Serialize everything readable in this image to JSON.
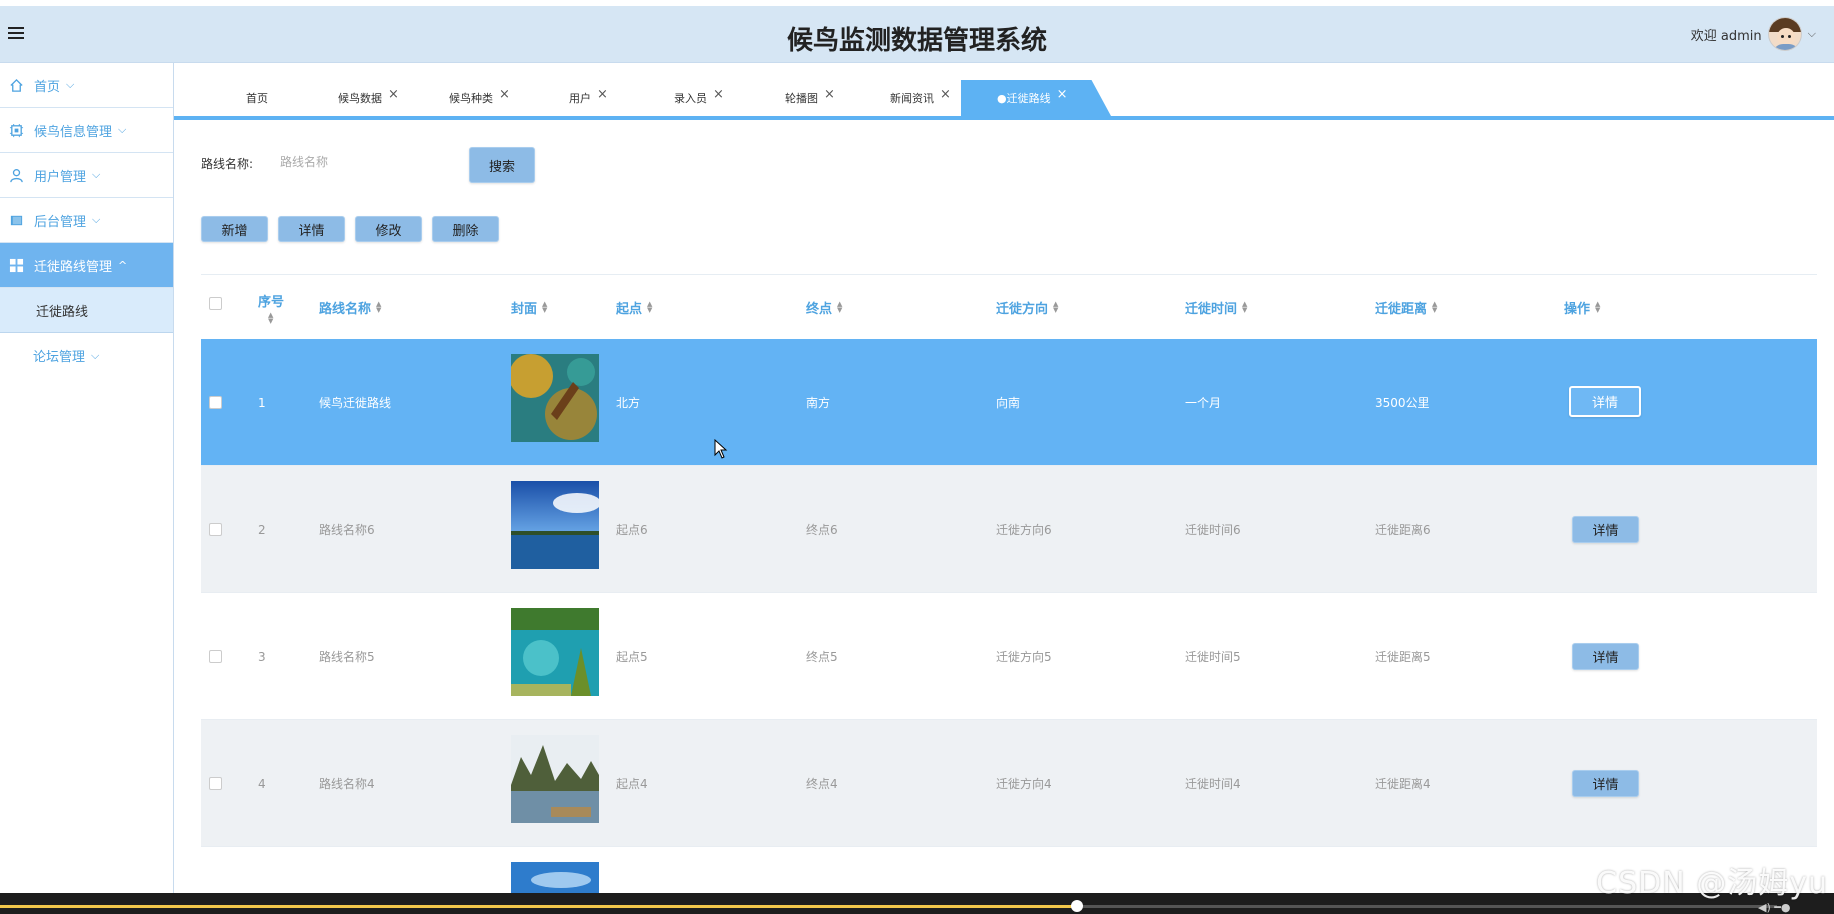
{
  "header": {
    "title": "候鸟监测数据管理系统",
    "welcome": "欢迎 admin"
  },
  "sidebar": {
    "items": [
      {
        "label": "首页",
        "icon": "home-icon",
        "arrow": "⌵"
      },
      {
        "label": "候鸟信息管理",
        "icon": "chip-icon",
        "arrow": "⌵"
      },
      {
        "label": "用户管理",
        "icon": "user-icon",
        "arrow": "⌵"
      },
      {
        "label": "后台管理",
        "icon": "book-icon",
        "arrow": "⌵"
      },
      {
        "label": "迁徙路线管理",
        "icon": "grid-icon",
        "arrow": "^"
      },
      {
        "label": "迁徙路线"
      },
      {
        "label": "论坛管理",
        "arrow": "⌵"
      }
    ]
  },
  "tabs": [
    {
      "label": "首页"
    },
    {
      "label": "候鸟数据",
      "close": "×"
    },
    {
      "label": "候鸟种类",
      "close": "×"
    },
    {
      "label": "用户",
      "close": "×"
    },
    {
      "label": "录入员",
      "close": "×"
    },
    {
      "label": "轮播图",
      "close": "×"
    },
    {
      "label": "新闻资讯",
      "close": "×"
    },
    {
      "label": "●迁徙路线",
      "close": "×"
    }
  ],
  "search": {
    "label": "路线名称:",
    "placeholder": "路线名称",
    "button": "搜索"
  },
  "actions": {
    "add": "新增",
    "detail": "详情",
    "edit": "修改",
    "delete": "删除"
  },
  "table": {
    "columns": [
      "序号",
      "路线名称",
      "封面",
      "起点",
      "终点",
      "迁徙方向",
      "迁徙时间",
      "迁徙距离",
      "操作"
    ],
    "rows": [
      {
        "index": "1",
        "name": "候鸟迁徙路线",
        "start": "北方",
        "end": "南方",
        "direction": "向南",
        "time": "一个月",
        "distance": "3500公里",
        "action": "详情"
      },
      {
        "index": "2",
        "name": "路线名称6",
        "start": "起点6",
        "end": "终点6",
        "direction": "迁徙方向6",
        "time": "迁徙时间6",
        "distance": "迁徙距离6",
        "action": "详情"
      },
      {
        "index": "3",
        "name": "路线名称5",
        "start": "起点5",
        "end": "终点5",
        "direction": "迁徙方向5",
        "time": "迁徙时间5",
        "distance": "迁徙距离5",
        "action": "详情"
      },
      {
        "index": "4",
        "name": "路线名称4",
        "start": "起点4",
        "end": "终点4",
        "direction": "迁徙方向4",
        "time": "迁徙时间4",
        "distance": "迁徙距离4",
        "action": "详情"
      }
    ]
  },
  "watermark": "CSDN @汤姆yu",
  "colors": {
    "accent": "#5db2f3",
    "header_bg": "#d6e6f4",
    "selected_row": "#63b3f4",
    "button": "#8dbbe6"
  },
  "video": {
    "progress": 0.587
  }
}
